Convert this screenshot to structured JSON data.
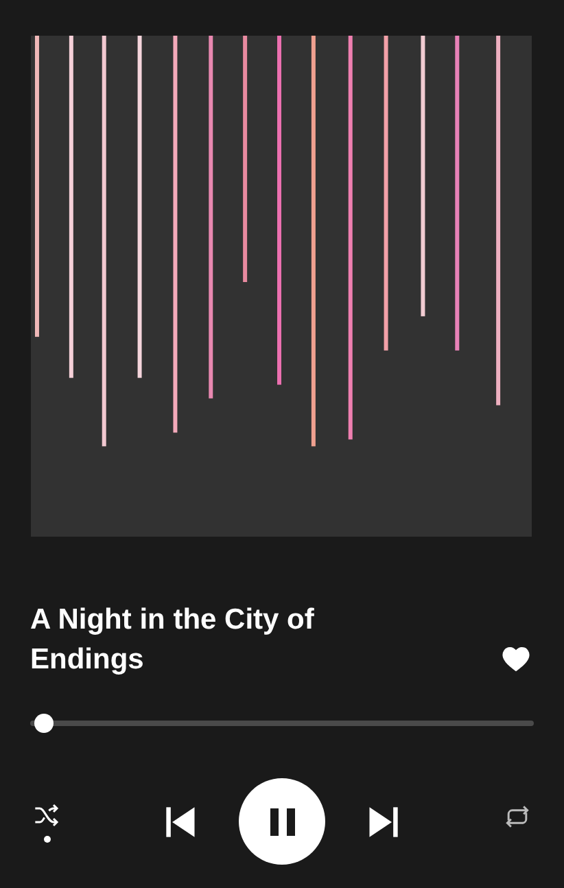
{
  "track": {
    "title": "A Night in the City of Endings",
    "liked": true
  },
  "progress": {
    "level": 0.02
  },
  "controls": {
    "shuffle": true,
    "playing": true,
    "repeat": false
  }
}
